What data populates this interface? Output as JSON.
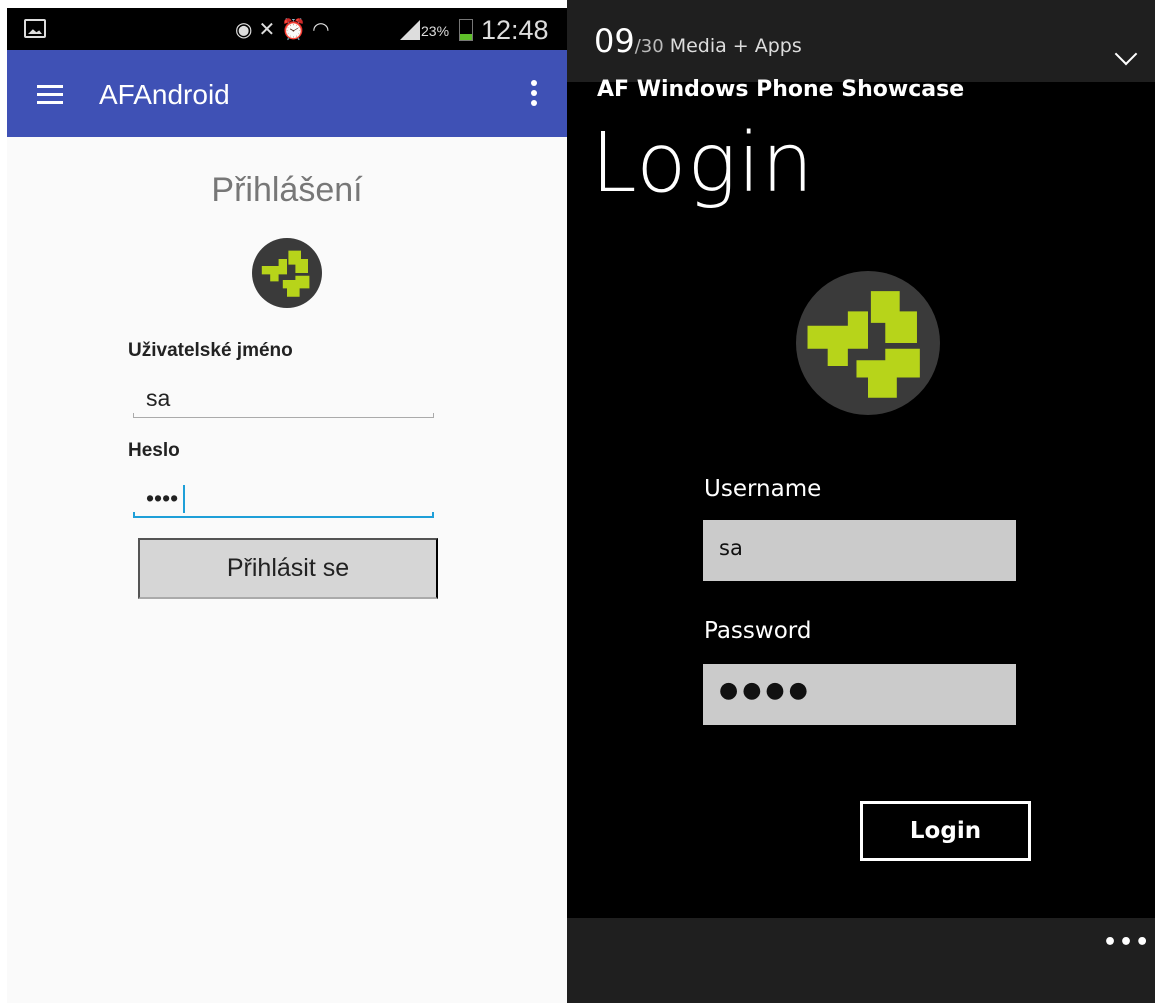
{
  "android": {
    "status_bar": {
      "icons": [
        "gallery-icon",
        "eye-icon",
        "mute-icon",
        "alarm-icon",
        "wifi-icon",
        "signal-icon",
        "battery-icon"
      ],
      "battery_percent": "23%",
      "time": "12:48"
    },
    "app_bar": {
      "title": "AFAndroid"
    },
    "form": {
      "title": "Přihlášení",
      "username_label": "Uživatelské jméno",
      "username_value": "sa",
      "password_label": "Heslo",
      "password_value": "••••",
      "submit_label": "Přihlásit se"
    },
    "colors": {
      "app_bar": "#3f51b5",
      "focus": "#1e9fd8",
      "logo_green": "#b7d41a"
    }
  },
  "windows_phone": {
    "header": {
      "current": "09",
      "total": "/30",
      "category": "Media + Apps"
    },
    "app_title": "AF Windows Phone Showcase",
    "page_title": "Login",
    "form": {
      "username_label": "Username",
      "username_value": "sa",
      "password_label": "Password",
      "password_value": "●●●●",
      "submit_label": "Login"
    },
    "app_bar": {
      "more_label": "•••"
    }
  }
}
